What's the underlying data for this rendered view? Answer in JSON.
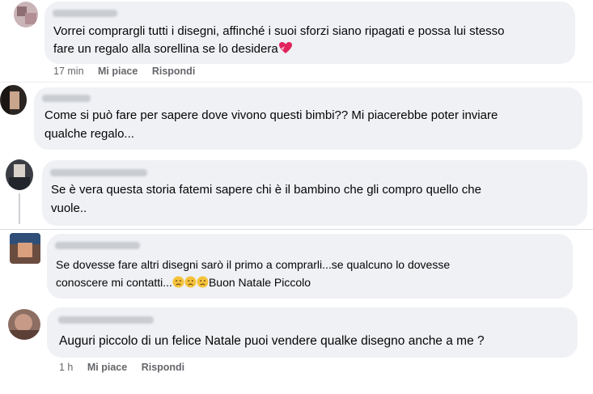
{
  "comments": [
    {
      "text_lines": [
        "Vorrei comprargli tutti i disegni, affinché i suoi sforzi siano ripagati e possa lui stesso",
        "fare un regalo alla sorellina se lo desidera"
      ],
      "emoji": "heart-with-ribbon",
      "time": "17 min",
      "like_label": "Mi piace",
      "reply_label": "Rispondi"
    },
    {
      "text_lines": [
        "Come si può fare per sapere dove vivono questi bimbi?? Mi piacerebbe poter inviare",
        "qualche regalo..."
      ]
    },
    {
      "text_lines": [
        "Se è vera questa storia fatemi sapere chi è il bambino che gli compro quello che",
        "vuole.."
      ]
    },
    {
      "text_lines": [
        "Se dovesse fare altri disegni sarò il primo a comprarli...se qualcuno lo dovesse",
        "conoscere mi contatti..."
      ],
      "line2_suffix": "Buon Natale Piccolo",
      "emoji": "disappointed-face x3"
    },
    {
      "text_lines": [
        "Auguri piccolo di un felice Natale puoi vendere qualke disegno anche a me ?"
      ],
      "time": "1 h",
      "like_label": "Mi piace",
      "reply_label": "Rispondi"
    }
  ],
  "colors": {
    "bubble_bg": "#eff1f4",
    "meta_text": "#65676b",
    "heart": "#e0245e",
    "emoji_face": "#f5c33b"
  }
}
